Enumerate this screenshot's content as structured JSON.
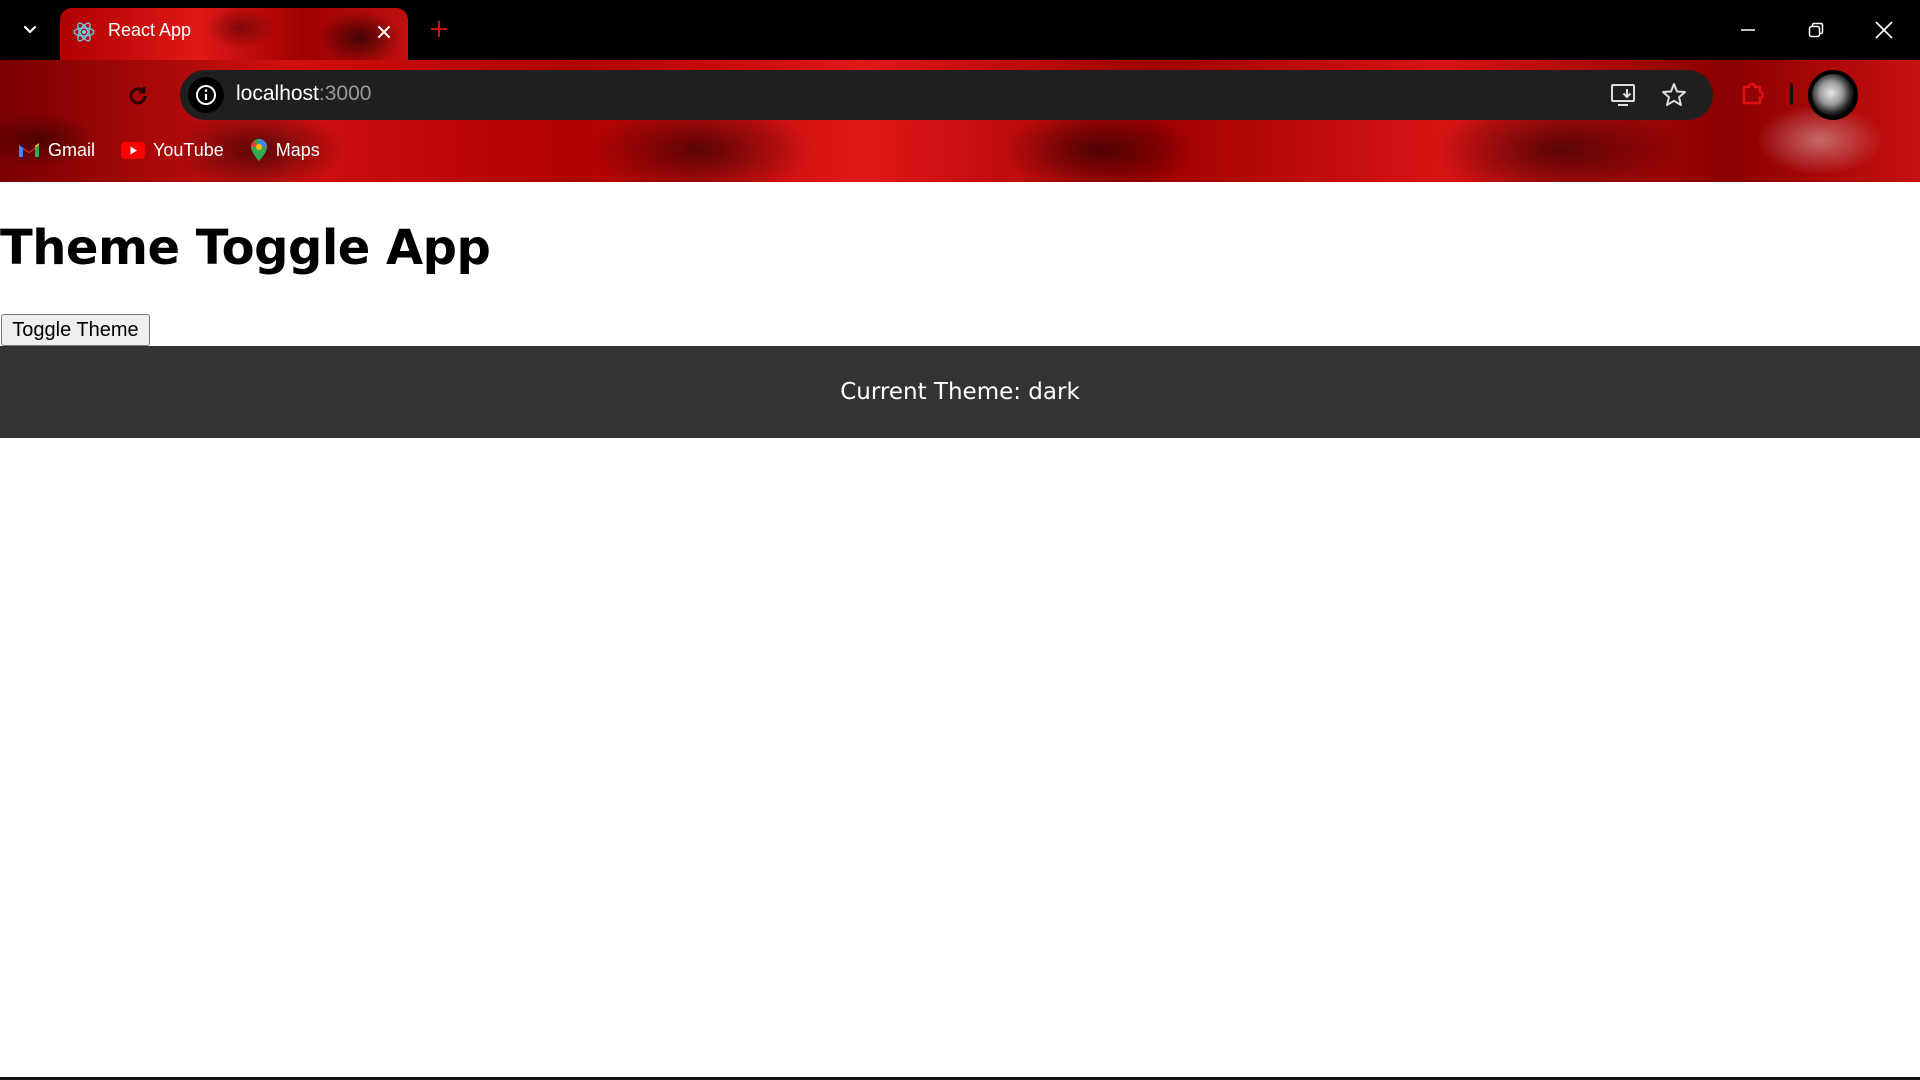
{
  "browser": {
    "tab": {
      "title": "React App",
      "favicon": "react-icon"
    },
    "url": {
      "host": "localhost",
      "port": ":3000"
    },
    "bookmarks": [
      {
        "label": "Gmail",
        "icon": "gmail-icon"
      },
      {
        "label": "YouTube",
        "icon": "youtube-icon"
      },
      {
        "label": "Maps",
        "icon": "maps-icon"
      }
    ],
    "colors": {
      "accent": "#d01010",
      "omnibox": "#1f1f1f",
      "titlebar": "#000000"
    }
  },
  "page": {
    "title": "Theme Toggle App",
    "toggle_button_label": "Toggle Theme",
    "theme_status": "Current Theme: dark",
    "colors": {
      "theme_bar": "#333333",
      "background": "#ffffff"
    }
  }
}
